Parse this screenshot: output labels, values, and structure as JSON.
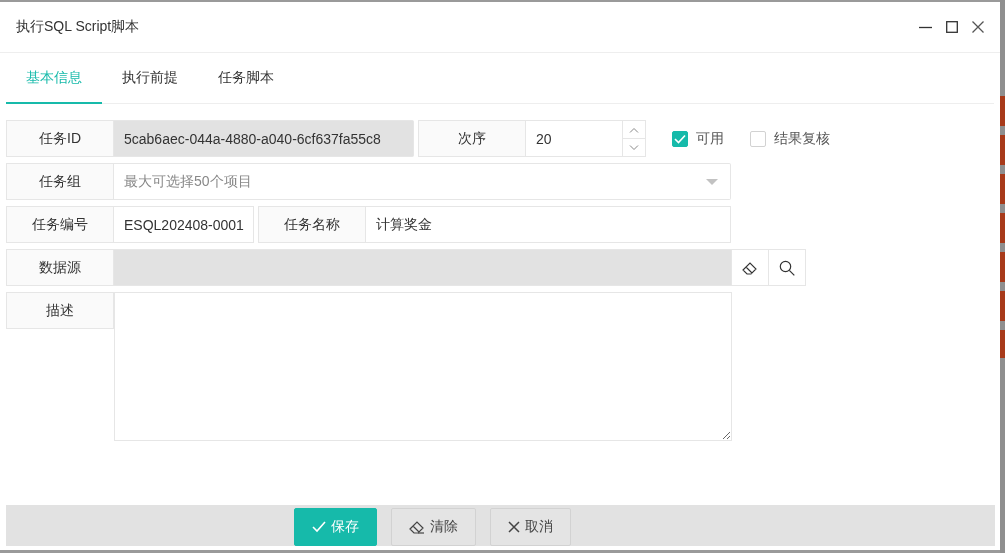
{
  "window": {
    "title": "执行SQL Script脚本"
  },
  "tabs": [
    {
      "label": "基本信息",
      "selected": true
    },
    {
      "label": "执行前提",
      "selected": false
    },
    {
      "label": "任务脚本",
      "selected": false
    }
  ],
  "form": {
    "task_id": {
      "label": "任务ID",
      "value": "5cab6aec-044a-4880-a040-6cf637fa55c8",
      "disabled": true
    },
    "order": {
      "label": "次序",
      "value": "20"
    },
    "checkboxes": [
      {
        "label": "可用",
        "checked": true
      },
      {
        "label": "结果复核",
        "checked": false
      }
    ],
    "task_group": {
      "label": "任务组",
      "placeholder": "最大可选择50个项目"
    },
    "task_code": {
      "label": "任务编号",
      "value": "ESQL202408-0001"
    },
    "task_name": {
      "label": "任务名称",
      "value": "计算奖金"
    },
    "data_source": {
      "label": "数据源",
      "disabled": true
    },
    "description": {
      "label": "描述"
    }
  },
  "buttons": [
    {
      "kind": "save",
      "label": "保存"
    },
    {
      "kind": "clear",
      "label": "清除"
    },
    {
      "kind": "cancel",
      "label": "取消"
    }
  ]
}
